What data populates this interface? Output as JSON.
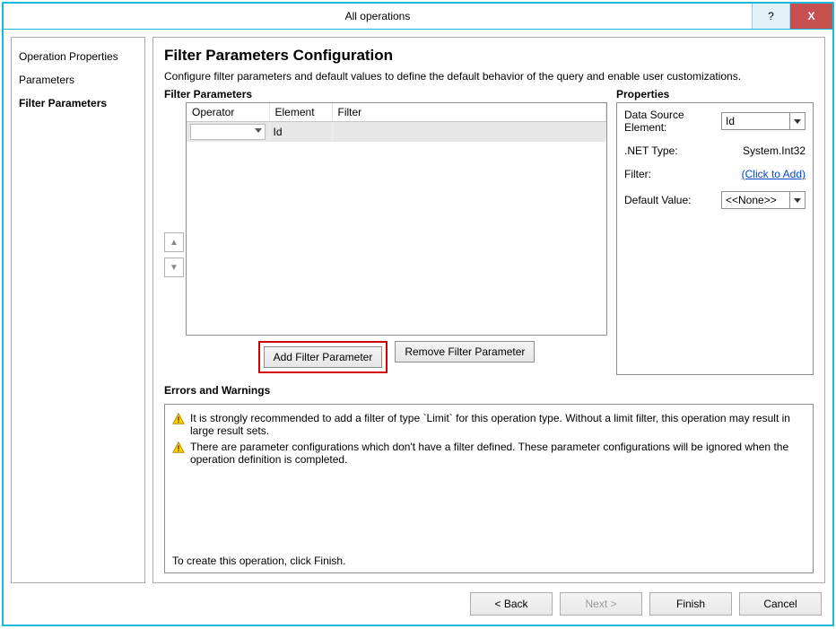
{
  "window": {
    "title": "All operations",
    "help": "?",
    "close": "X"
  },
  "nav": {
    "items": [
      {
        "label": "Operation Properties"
      },
      {
        "label": "Parameters"
      },
      {
        "label": "Filter Parameters"
      }
    ]
  },
  "page": {
    "heading": "Filter Parameters Configuration",
    "desc": "Configure filter parameters and default values to define the default behavior of the query and enable user customizations.",
    "filter_section": "Filter Parameters",
    "props_section": "Properties"
  },
  "filter_table": {
    "cols": {
      "operator": "Operator",
      "element": "Element",
      "filter": "Filter"
    },
    "row": {
      "operator": "",
      "element": "Id",
      "filter": ""
    }
  },
  "filter_actions": {
    "add": "Add Filter Parameter",
    "remove": "Remove Filter Parameter"
  },
  "props": {
    "dse_label": "Data Source Element:",
    "dse_value": "Id",
    "net_label": ".NET Type:",
    "net_value": "System.Int32",
    "filter_label": "Filter:",
    "filter_value": "(Click to Add)",
    "default_label": "Default Value:",
    "default_value": "<<None>>"
  },
  "errors": {
    "heading": "Errors and Warnings",
    "items": [
      "It is strongly recommended to add a filter of type `Limit` for this operation type. Without a limit filter, this operation may result in large result sets.",
      "There are parameter configurations which don't have a filter defined. These parameter configurations will be ignored when the operation definition is completed."
    ],
    "footer": "To create this operation, click Finish."
  },
  "buttons": {
    "back": "< Back",
    "next": "Next >",
    "finish": "Finish",
    "cancel": "Cancel"
  }
}
